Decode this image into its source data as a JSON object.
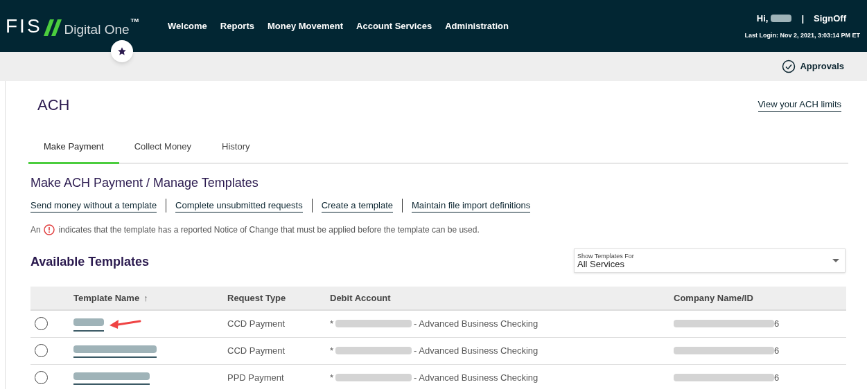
{
  "header": {
    "logo": {
      "mark": "FIS",
      "product": "Digital One",
      "trademark": "TM"
    },
    "nav": [
      {
        "label": "Welcome"
      },
      {
        "label": "Reports"
      },
      {
        "label": "Money Movement"
      },
      {
        "label": "Account Services"
      },
      {
        "label": "Administration"
      }
    ],
    "greeting": "Hi,",
    "separator": "|",
    "signoff": "SignOff",
    "last_login": "Last Login: Nov 2, 2021, 3:03:14 PM ET"
  },
  "toolbar": {
    "approvals": "Approvals"
  },
  "page": {
    "title": "ACH",
    "limits_link": "View your ACH limits"
  },
  "tabs": [
    {
      "label": "Make Payment",
      "selected": true
    },
    {
      "label": "Collect Money",
      "selected": false
    },
    {
      "label": "History",
      "selected": false
    }
  ],
  "section_title": "Make ACH Payment / Manage Templates",
  "links": [
    "Send money without a template",
    "Complete unsubmitted requests",
    "Create a template",
    "Maintain file import definitions"
  ],
  "notice": {
    "before": "An",
    "after": "indicates that the template has a reported Notice of Change that must be applied before the template can be used."
  },
  "templates": {
    "title": "Available Templates",
    "filter": {
      "label": "Show Templates For",
      "value": "All Services"
    },
    "columns": [
      {
        "label": "Template Name",
        "sort": "↑"
      },
      {
        "label": "Request Type"
      },
      {
        "label": "Debit Account"
      },
      {
        "label": "Company Name/ID"
      }
    ],
    "rows": [
      {
        "selected": false,
        "pointed": true,
        "request_type": "CCD Payment",
        "debit_prefix": "*",
        "debit_suffix": "- Advanced Business Checking",
        "company_suffix": "6"
      },
      {
        "selected": false,
        "pointed": false,
        "request_type": "CCD Payment",
        "debit_prefix": "*",
        "debit_suffix": "- Advanced Business Checking",
        "company_suffix": "6"
      },
      {
        "selected": false,
        "pointed": false,
        "request_type": "PPD Payment",
        "debit_prefix": "*",
        "debit_suffix": "- Advanced Business Checking",
        "company_suffix": "6"
      }
    ]
  }
}
